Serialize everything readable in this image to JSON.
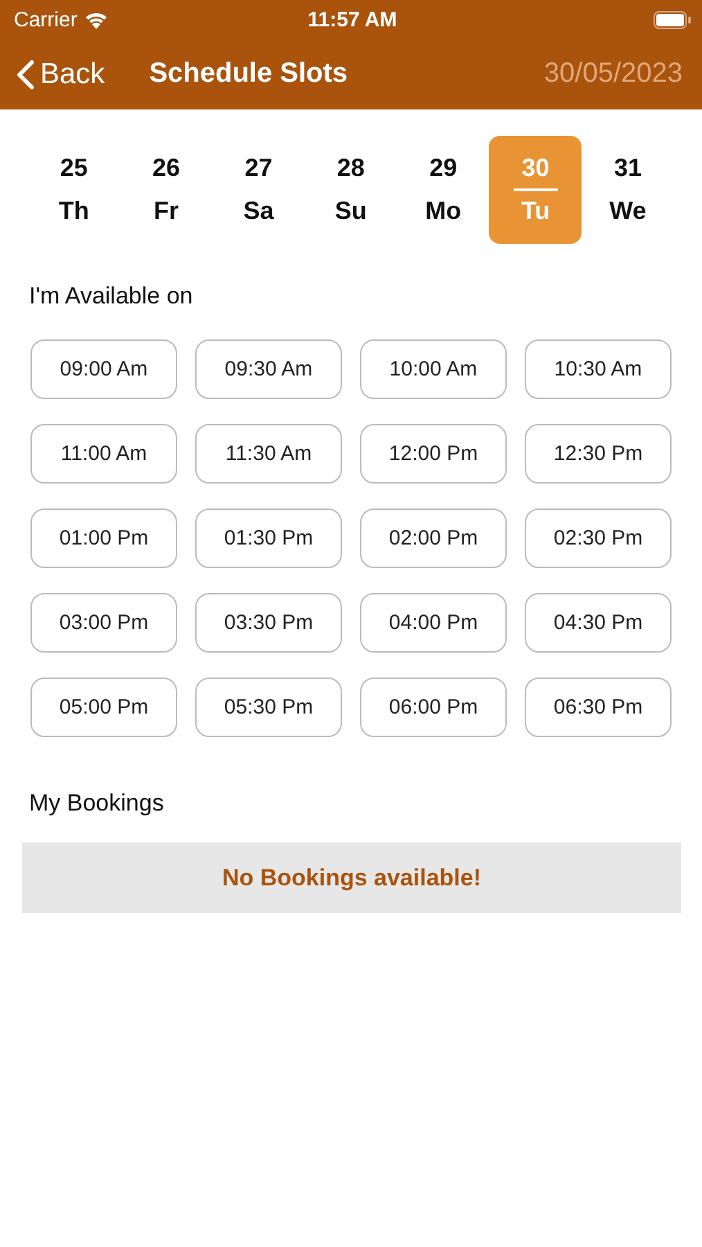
{
  "status_bar": {
    "carrier": "Carrier",
    "time": "11:57 AM"
  },
  "nav": {
    "back": "Back",
    "title": "Schedule Slots",
    "date": "30/05/2023"
  },
  "days": [
    {
      "date": "25",
      "weekday": "Th",
      "selected": false
    },
    {
      "date": "26",
      "weekday": "Fr",
      "selected": false
    },
    {
      "date": "27",
      "weekday": "Sa",
      "selected": false
    },
    {
      "date": "28",
      "weekday": "Su",
      "selected": false
    },
    {
      "date": "29",
      "weekday": "Mo",
      "selected": false
    },
    {
      "date": "30",
      "weekday": "Tu",
      "selected": true
    },
    {
      "date": "31",
      "weekday": "We",
      "selected": false
    }
  ],
  "availability": {
    "heading": "I'm Available on",
    "slots": [
      "09:00 Am",
      "09:30 Am",
      "10:00 Am",
      "10:30 Am",
      "11:00 Am",
      "11:30 Am",
      "12:00 Pm",
      "12:30 Pm",
      "01:00 Pm",
      "01:30 Pm",
      "02:00 Pm",
      "02:30 Pm",
      "03:00 Pm",
      "03:30 Pm",
      "04:00 Pm",
      "04:30 Pm",
      "05:00 Pm",
      "05:30 Pm",
      "06:00 Pm",
      "06:30 Pm"
    ]
  },
  "bookings": {
    "heading": "My Bookings",
    "empty_message": "No Bookings available!"
  }
}
